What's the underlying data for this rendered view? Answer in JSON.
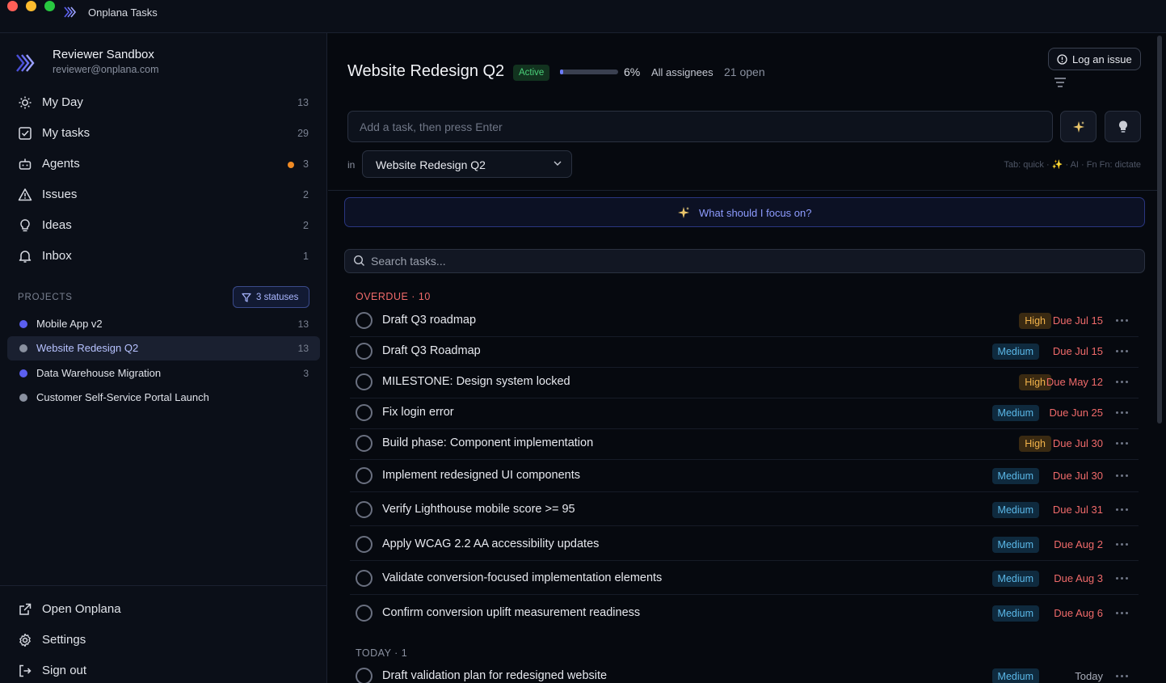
{
  "window": {
    "title": "Onplana Tasks"
  },
  "account": {
    "name": "Reviewer Sandbox",
    "email": "reviewer@onplana.com"
  },
  "nav": {
    "items": [
      {
        "label": "My Day",
        "count": "13"
      },
      {
        "label": "My tasks",
        "count": "29"
      },
      {
        "label": "Agents",
        "count": "3"
      },
      {
        "label": "Issues",
        "count": "2"
      },
      {
        "label": "Ideas",
        "count": "2"
      },
      {
        "label": "Inbox",
        "count": "1"
      }
    ]
  },
  "projects": {
    "heading": "PROJECTS",
    "filter_label": "3 statuses",
    "items": [
      {
        "label": "Mobile App v2",
        "count": "13",
        "color": "#5b5ff0"
      },
      {
        "label": "Website Redesign Q2",
        "count": "13",
        "color": "#8a91a0"
      },
      {
        "label": "Data Warehouse Migration",
        "count": "3",
        "color": "#5b5ff0"
      },
      {
        "label": "Customer Self-Service Portal Launch",
        "count": "",
        "color": "#8a91a0"
      }
    ]
  },
  "footer_nav": {
    "open": "Open Onplana",
    "settings": "Settings",
    "signout": "Sign out"
  },
  "header": {
    "project_title": "Website Redesign Q2",
    "status": "Active",
    "progress_pct": 6,
    "progress_label": "6%",
    "assignees": "All assignees",
    "open_count": "21 open",
    "log_issue": "Log an issue"
  },
  "composer": {
    "placeholder": "Add a task, then press Enter",
    "in_label": "in",
    "project_select": "Website Redesign Q2",
    "hint": "Tab: quick · ✨ · AI · Fn Fn: dictate"
  },
  "focus_prompt": "What should I focus on?",
  "search": {
    "placeholder": "Search tasks..."
  },
  "sections": {
    "overdue": {
      "label": "OVERDUE · 10",
      "tasks": [
        {
          "title": "Draft Q3 roadmap",
          "priority": "High",
          "due": "Due Jul 15"
        },
        {
          "title": "Draft Q3 Roadmap",
          "priority": "Medium",
          "due": "Due Jul 15"
        },
        {
          "title": "MILESTONE: Design system locked",
          "priority": "High",
          "due": "Due May 12"
        },
        {
          "title": "Fix login error",
          "priority": "Medium",
          "due": "Due Jun 25"
        },
        {
          "title": "Build phase: Component implementation",
          "priority": "High",
          "due": "Due Jul 30"
        },
        {
          "title": "Implement redesigned UI components",
          "priority": "Medium",
          "due": "Due Jul 30"
        },
        {
          "title": "Verify Lighthouse mobile score >= 95",
          "priority": "Medium",
          "due": "Due Jul 31"
        },
        {
          "title": "Apply WCAG 2.2 AA accessibility updates",
          "priority": "Medium",
          "due": "Due Aug 2"
        },
        {
          "title": "Validate conversion-focused implementation elements",
          "priority": "Medium",
          "due": "Due Aug 3"
        },
        {
          "title": "Confirm conversion uplift measurement readiness",
          "priority": "Medium",
          "due": "Due Aug 6"
        }
      ]
    },
    "today": {
      "label": "TODAY · 1",
      "tasks": [
        {
          "title": "Draft validation plan for redesigned website",
          "priority": "Medium",
          "due": "Today"
        }
      ]
    }
  },
  "colors": {
    "accent": "#6b7bff",
    "overdue": "#f06a6a",
    "high": "#f3b34a",
    "medium": "#5bb8e8",
    "active": "#4bd17a"
  }
}
